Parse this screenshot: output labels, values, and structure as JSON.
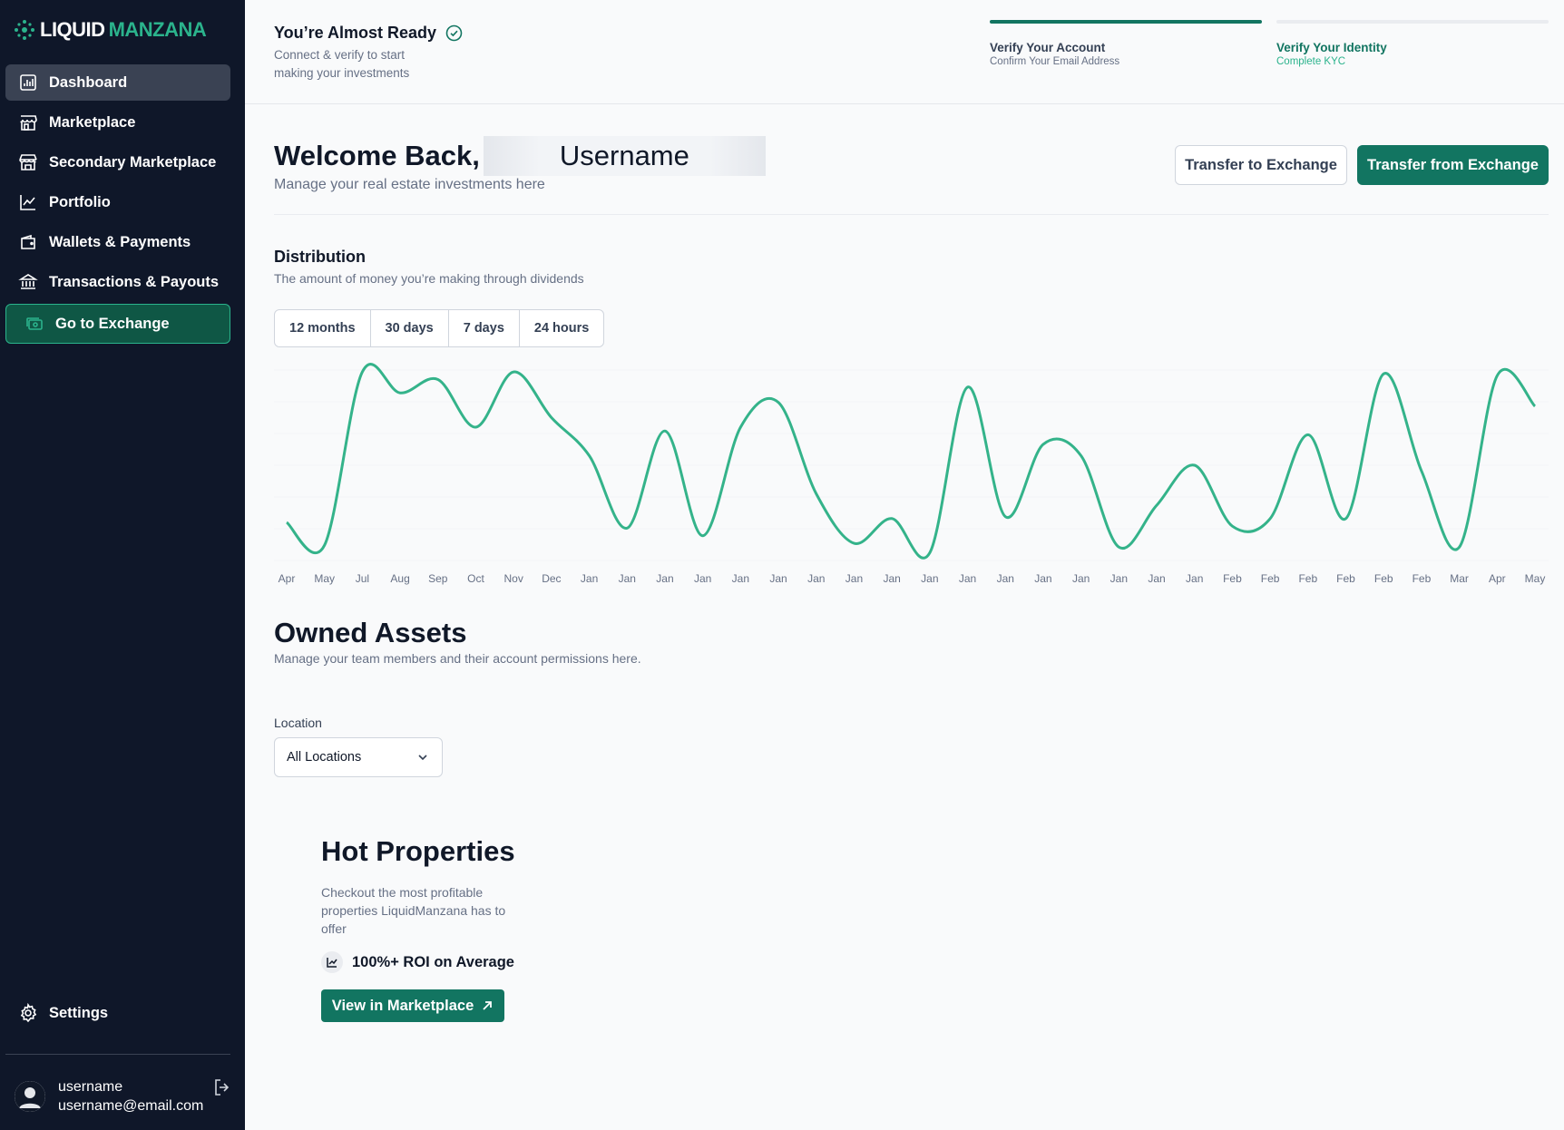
{
  "brand": {
    "part1": "LIQUID",
    "part2": "MANZANA"
  },
  "sidebar": {
    "items": [
      {
        "label": "Dashboard",
        "icon": "bar-chart-icon"
      },
      {
        "label": "Marketplace",
        "icon": "storefront-icon"
      },
      {
        "label": "Secondary Marketplace",
        "icon": "store-icon"
      },
      {
        "label": "Portfolio",
        "icon": "line-chart-icon"
      },
      {
        "label": "Wallets & Payments",
        "icon": "wallet-icon"
      },
      {
        "label": "Transactions & Payouts",
        "icon": "bank-icon"
      },
      {
        "label": "Go to Exchange",
        "icon": "cash-icon"
      }
    ],
    "settings_label": "Settings",
    "user": {
      "name": "username",
      "email": "username@email.com"
    }
  },
  "onboarding": {
    "title": "You’re Almost Ready",
    "subtitle": "Connect & verify to start making your investments",
    "steps": [
      {
        "title": "Verify Your Account",
        "subtitle": "Confirm Your Email Address",
        "complete": true
      },
      {
        "title": "Verify Your Identity",
        "subtitle": "Complete KYC",
        "complete": false
      }
    ]
  },
  "welcome": {
    "greeting": "Welcome Back,",
    "username": "Username",
    "subtitle": "Manage your real estate investments here",
    "transfer_to_label": "Transfer to Exchange",
    "transfer_from_label": "Transfer from Exchange"
  },
  "distribution": {
    "title": "Distribution",
    "subtitle": "The amount of money you’re making through dividends",
    "ranges": [
      "12 months",
      "30 days",
      "7 days",
      "24 hours"
    ]
  },
  "chart_data": {
    "type": "line",
    "title": "Distribution",
    "x": [
      "Apr",
      "May",
      "Jul",
      "Aug",
      "Sep",
      "Oct",
      "Nov",
      "Dec",
      "Jan",
      "Jan",
      "Jan",
      "Jan",
      "Jan",
      "Jan",
      "Jan",
      "Jan",
      "Jan",
      "Jan",
      "Jan",
      "Jan",
      "Jan",
      "Jan",
      "Jan",
      "Jan",
      "Jan",
      "Feb",
      "Feb",
      "Feb",
      "Feb",
      "Feb",
      "Feb",
      "Mar",
      "Apr",
      "May"
    ],
    "series": [
      {
        "values": [
          0.2,
          0.08,
          0.99,
          0.88,
          0.95,
          0.7,
          0.99,
          0.75,
          0.55,
          0.17,
          0.68,
          0.13,
          0.7,
          0.83,
          0.35,
          0.09,
          0.22,
          0.04,
          0.91,
          0.23,
          0.61,
          0.55,
          0.07,
          0.29,
          0.5,
          0.18,
          0.22,
          0.66,
          0.22,
          0.98,
          0.47,
          0.07,
          0.97,
          0.81
        ]
      }
    ],
    "ylim": [
      0,
      1
    ],
    "color": "#34b38a",
    "grid": true
  },
  "owned": {
    "title": "Owned Assets",
    "subtitle": "Manage your team members and their account permissions here.",
    "location_label": "Location",
    "location_value": "All Locations"
  },
  "hot": {
    "title": "Hot Properties",
    "subtitle": "Checkout the most profitable properties LiquidManzana has to offer",
    "roi": "100%+ ROI on Average",
    "button": "View in Marketplace"
  }
}
